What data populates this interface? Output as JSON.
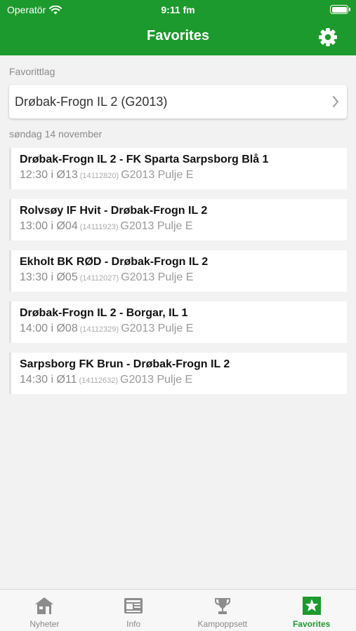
{
  "status_bar": {
    "carrier": "Operatör",
    "time": "9:11 fm"
  },
  "header": {
    "title": "Favorites"
  },
  "favorites": {
    "section_label": "Favorittlag",
    "team": "Drøbak-Frogn IL 2 (G2013)"
  },
  "schedule": {
    "date_label": "søndag 14 november",
    "matches": [
      {
        "title": "Drøbak-Frogn IL 2 - FK Sparta Sarpsborg Blå 1",
        "time": "12:30 i Ø13",
        "id": "(14112820)",
        "group": "G2013 Pulje E"
      },
      {
        "title": "Rolvsøy IF Hvit - Drøbak-Frogn IL 2",
        "time": "13:00 i Ø04",
        "id": "(14111923)",
        "group": "G2013 Pulje E"
      },
      {
        "title": "Ekholt BK RØD - Drøbak-Frogn IL 2",
        "time": "13:30 i Ø05",
        "id": "(14112027)",
        "group": "G2013 Pulje E"
      },
      {
        "title": "Drøbak-Frogn IL 2 - Borgar, IL 1",
        "time": "14:00 i Ø08",
        "id": "(14112329)",
        "group": "G2013 Pulje E"
      },
      {
        "title": "Sarpsborg FK Brun - Drøbak-Frogn IL 2",
        "time": "14:30 i Ø11",
        "id": "(14112632)",
        "group": "G2013 Pulje E"
      }
    ]
  },
  "tabbar": {
    "items": [
      {
        "label": "Nyheter",
        "icon": "house-icon"
      },
      {
        "label": "Info",
        "icon": "newspaper-icon"
      },
      {
        "label": "Kampoppsett",
        "icon": "trophy-icon"
      },
      {
        "label": "Favorites",
        "icon": "star-icon",
        "active": true
      }
    ]
  },
  "colors": {
    "brand": "#1d9a2d",
    "inactive_tab": "#888888"
  }
}
